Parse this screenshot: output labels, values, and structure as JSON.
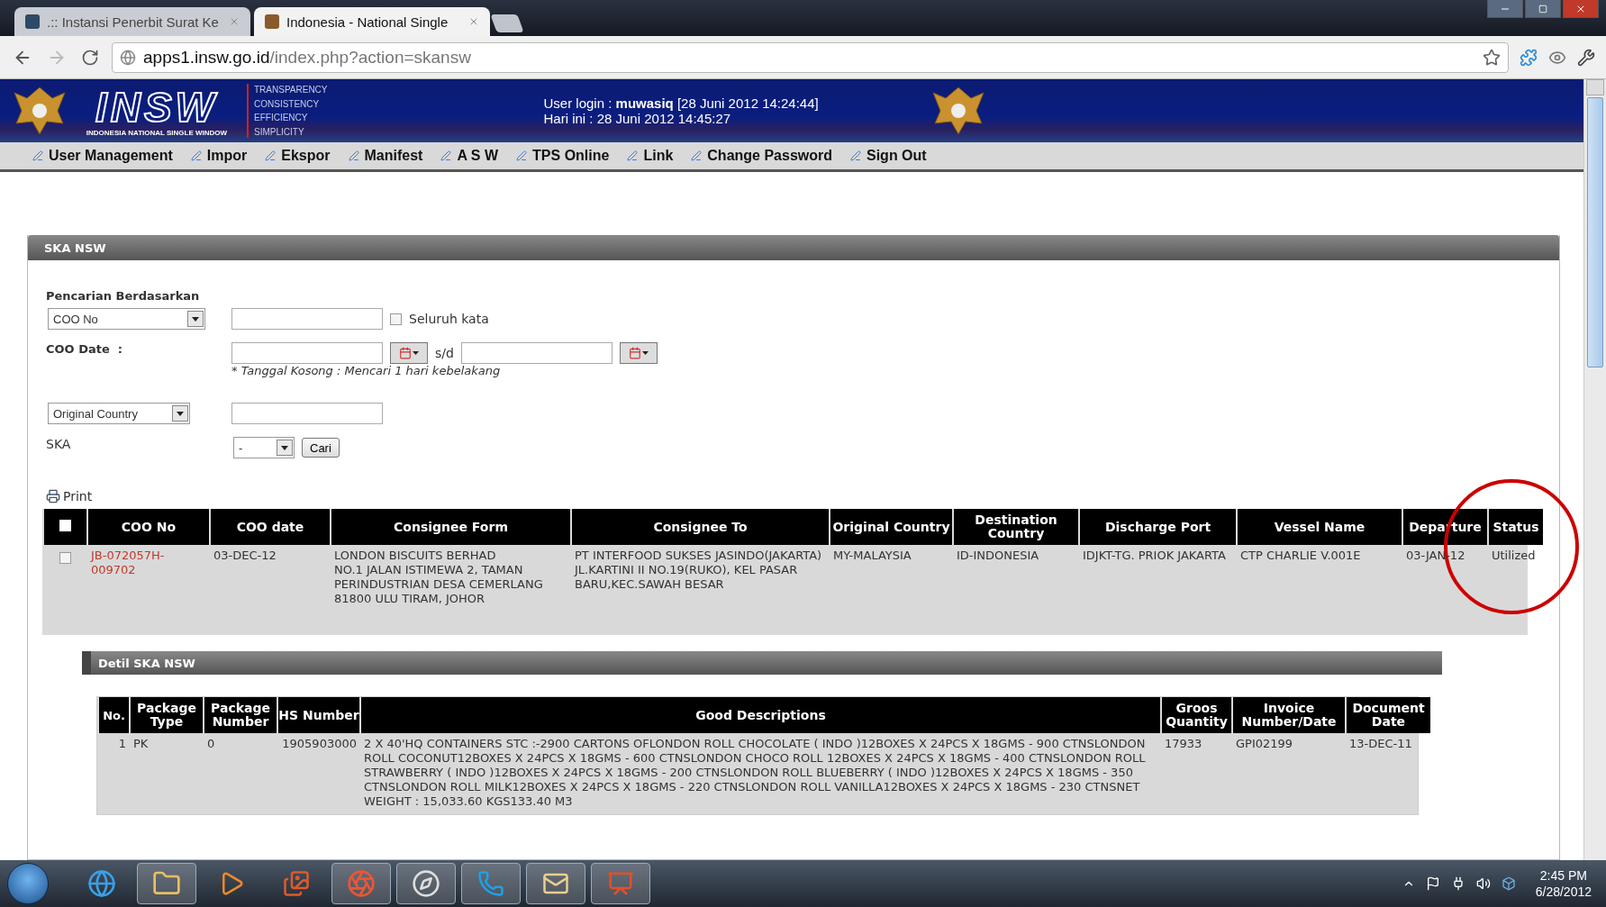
{
  "browser": {
    "tabs": [
      {
        "label": ".:: Instansi Penerbit Surat Ke",
        "selected": false
      },
      {
        "label": "Indonesia - National Single",
        "selected": true
      }
    ],
    "url_host": "apps1.insw.go.id",
    "url_path": "/index.php?action=skansw"
  },
  "header": {
    "logo_text": "INSW",
    "logo_caption": "INDONESIA NATIONAL SINGLE WINDOW",
    "mottos": [
      "TRANSPARENCY",
      "CONSISTENCY",
      "EFFICIENCY",
      "SIMPLICITY"
    ],
    "login_label": "User login :",
    "login_user": "muwasiq",
    "login_time": "[28 Juni 2012 14:24:44]",
    "today": "Hari ini : 28 Juni 2012 14:45:27"
  },
  "menu": [
    "User Management",
    "Impor",
    "Ekspor",
    "Manifest",
    "A S W",
    "TPS Online",
    "Link",
    "Change Password",
    "Sign Out"
  ],
  "panel": {
    "title": "SKA NSW"
  },
  "search": {
    "heading": "Pencarian Berdasarkan",
    "field_select": "COO No",
    "whole_word": {
      "label": "Seluruh kata",
      "checked": false
    },
    "date_label": "COO Date  :",
    "range_sep": "s/d",
    "date_note": "* Tanggal Kosong : Mencari 1 hari kebelakang",
    "country_select": "Original Country",
    "ska_label": "SKA",
    "ska_select": "-",
    "search_button": "Cari"
  },
  "print_link": "Print",
  "results": {
    "all_checked": false,
    "columns": [
      "COO No",
      "COO date",
      "Consignee Form",
      "Consignee To",
      "Original Country",
      "Destination Country",
      "Discharge Port",
      "Vessel Name",
      "Departure",
      "Status"
    ],
    "rows": [
      {
        "checked": false,
        "cells": [
          "JB-072057H-009702",
          "03-DEC-12",
          "LONDON BISCUITS BERHAD\nNO.1 JALAN ISTIMEWA 2, TAMAN PERINDUSTRIAN DESA CEMERLANG\n81800 ULU TIRAM, JOHOR",
          "PT INTERFOOD SUKSES JASINDO(JAKARTA)\nJL.KARTINI II NO.19(RUKO), KEL PASAR BARU,KEC.SAWAH BESAR",
          "MY-MALAYSIA",
          "ID-INDONESIA",
          "IDJKT-TG. PRIOK JAKARTA",
          "CTP CHARLIE V.001E",
          "03-JAN-12",
          "Utilized"
        ]
      }
    ]
  },
  "detail": {
    "title": "Detil SKA NSW",
    "columns": [
      "No.",
      "Package Type",
      "Package Number",
      "HS Number",
      "Good Descriptions",
      "Groos Quantity",
      "Invoice Number/Date",
      "Document Date"
    ],
    "rows": [
      {
        "cells": [
          "1",
          "PK",
          "0",
          "1905903000",
          "2 X 40'HQ CONTAINERS STC :-2900 CARTONS OFLONDON ROLL CHOCOLATE ( INDO )12BOXES X 24PCS X 18GMS - 900 CTNSLONDON ROLL COCONUT12BOXES X 24PCS X 18GMS - 600 CTNSLONDON CHOCO ROLL 12BOXES X 24PCS X 18GMS - 400 CTNSLONDON ROLL STRAWBERRY ( INDO )12BOXES X 24PCS X 18GMS - 200 CTNSLONDON ROLL BLUEBERRY ( INDO )12BOXES X 24PCS X 18GMS - 350 CTNSLONDON ROLL MILK12BOXES X 24PCS X 18GMS - 220 CTNSLONDON ROLL VANILLA12BOXES X 24PCS X 18GMS - 230 CTNSNET WEIGHT : 15,033.60 KGS133.40 M3",
          "17933",
          "GPI02199",
          "13-DEC-11"
        ]
      }
    ]
  },
  "taskbar": {
    "time": "2:45 PM",
    "date": "6/28/2012"
  }
}
